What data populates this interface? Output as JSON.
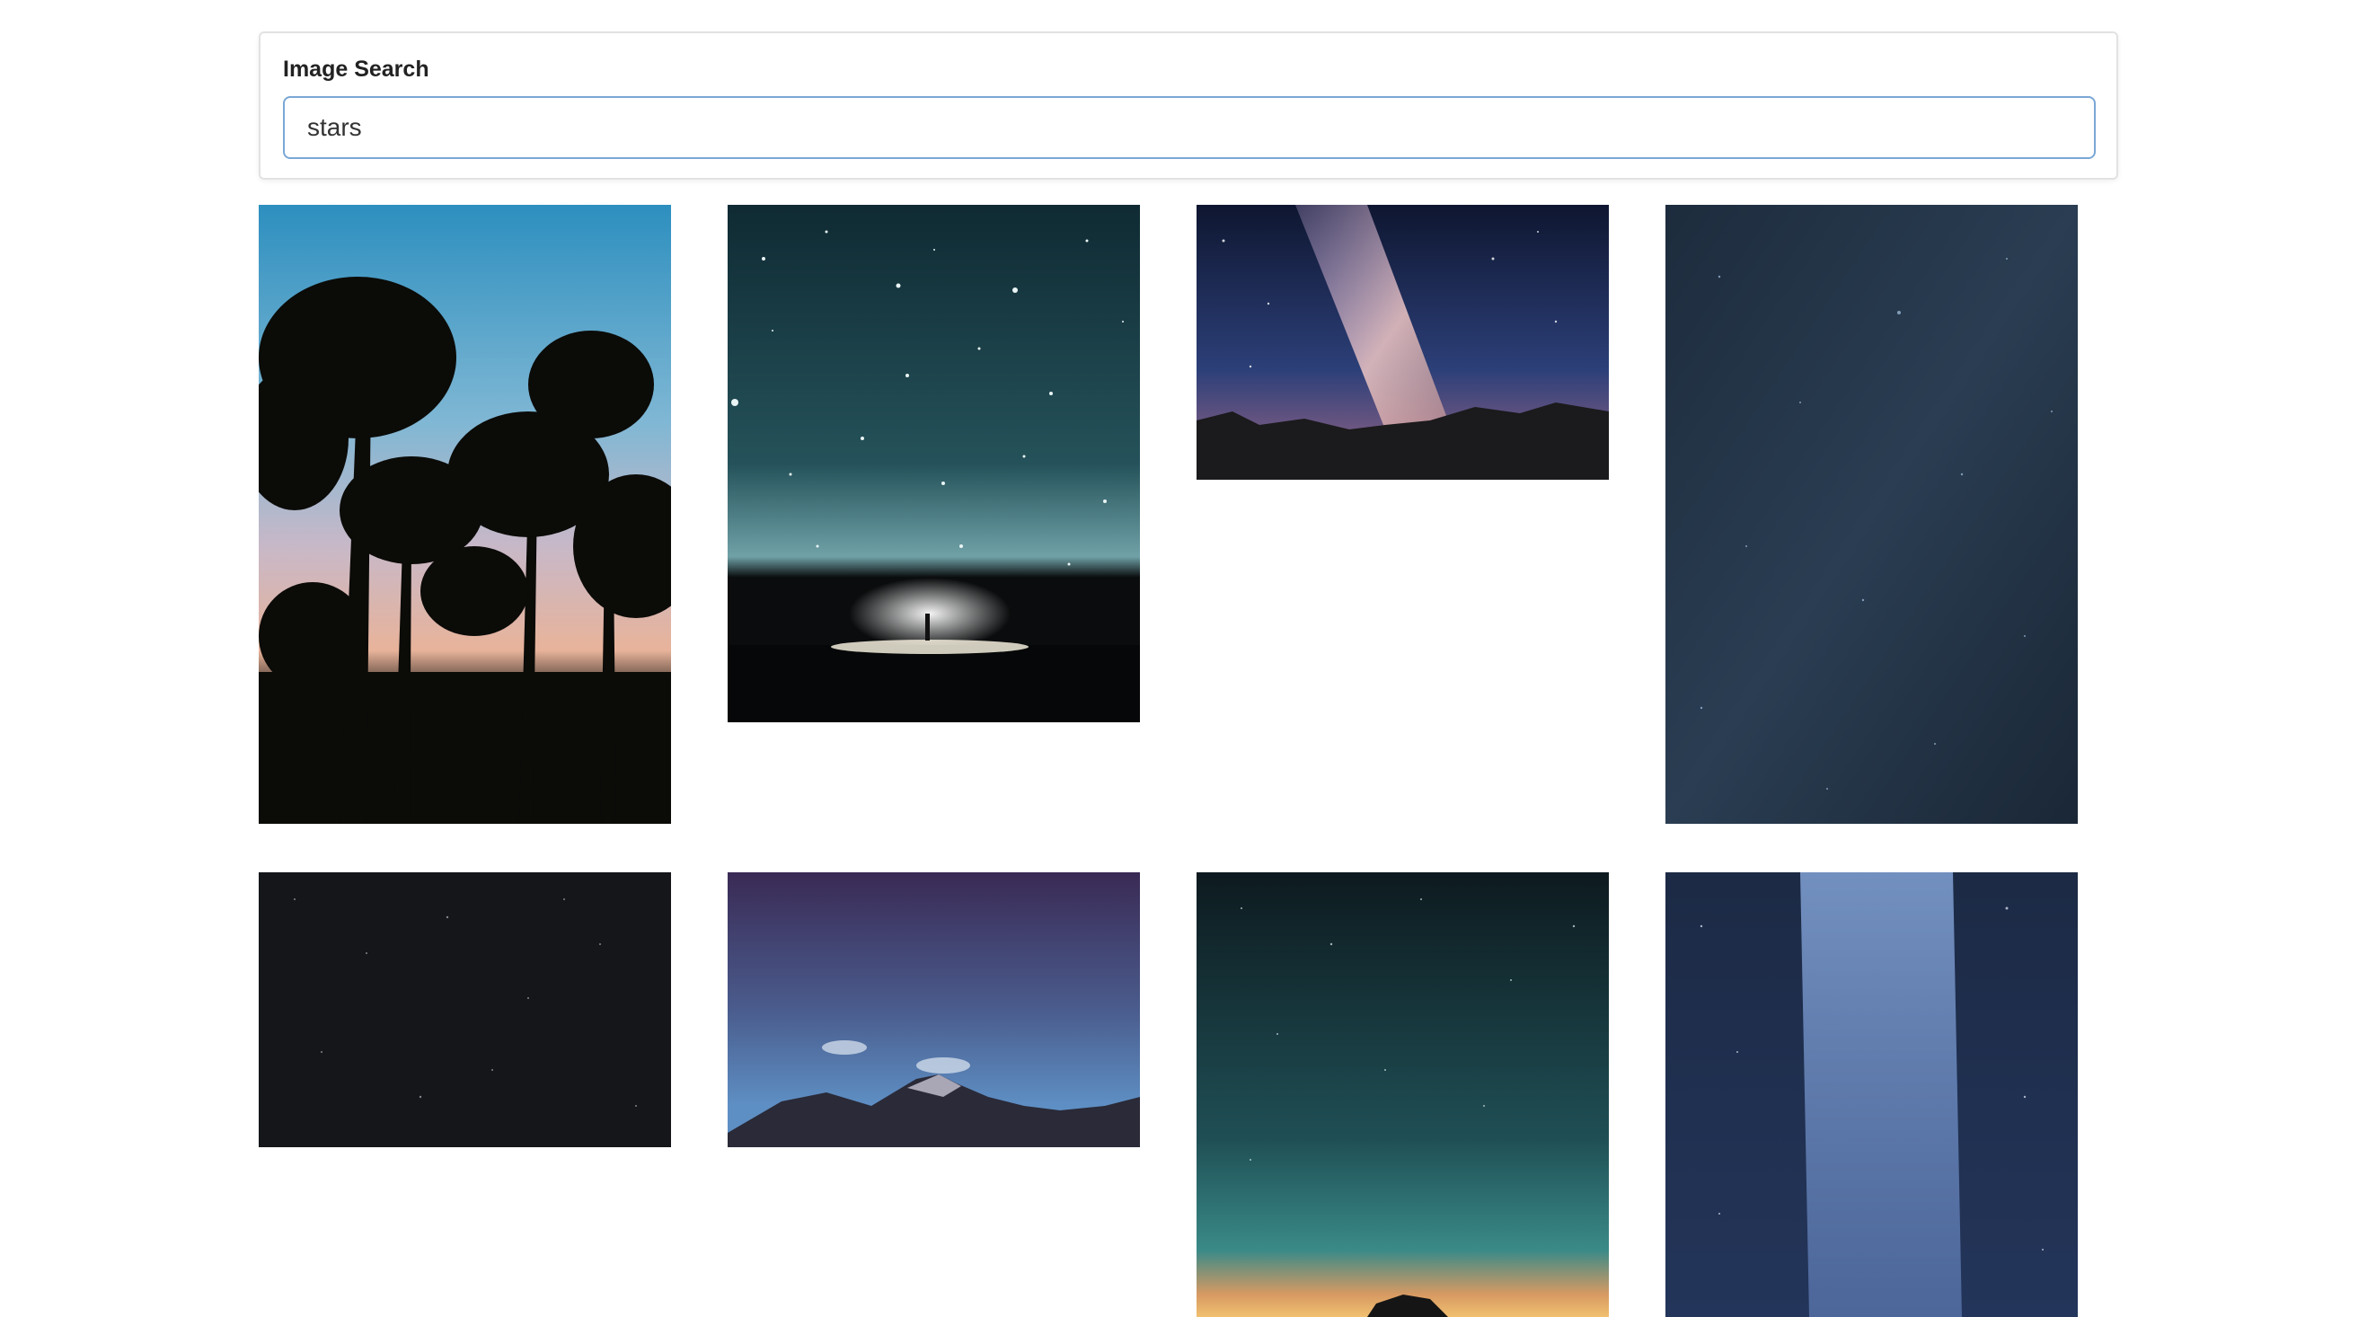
{
  "search": {
    "label": "Image Search",
    "value": "stars"
  },
  "gallery": {
    "images": [
      {
        "name": "palm-trees-sunset-photo"
      },
      {
        "name": "person-under-starry-sky-photo"
      },
      {
        "name": "milky-way-over-mountains-photo"
      },
      {
        "name": "blue-starfield-photo"
      },
      {
        "name": "dark-starfield-photo"
      },
      {
        "name": "purple-sky-mountain-peak-photo"
      },
      {
        "name": "teal-night-sky-horizon-photo"
      },
      {
        "name": "blue-milky-way-photo"
      }
    ]
  }
}
